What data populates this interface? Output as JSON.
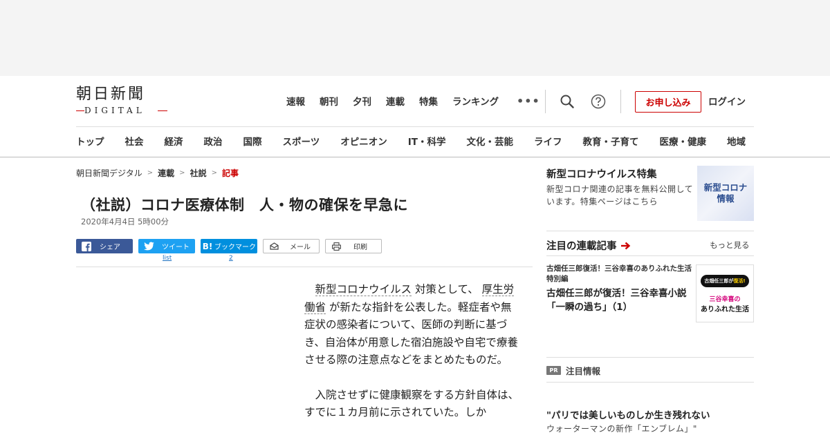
{
  "logo": {
    "main": "朝日新聞",
    "sub": "DIGITAL"
  },
  "topnav": [
    "速報",
    "朝刊",
    "夕刊",
    "連載",
    "特集",
    "ランキング"
  ],
  "topnav_more": "•••",
  "subscribe_label": "お申し込み",
  "login_label": "ログイン",
  "catnav": [
    "トップ",
    "社会",
    "経済",
    "政治",
    "国際",
    "スポーツ",
    "オピニオン",
    "IT・科学",
    "文化・芸能",
    "ライフ",
    "教育・子育て",
    "医療・健康",
    "地域"
  ],
  "breadcrumb": {
    "home": "朝日新聞デジタル",
    "section": "連載",
    "subsection": "社説",
    "current": "記事"
  },
  "article": {
    "title": "（社説）コロナ医療体制　人・物の確保を早急に",
    "date": "2020年4月4日 5時00分",
    "para1_link1": "新型コロナウイルス",
    "para1_text1": " 対策として、 ",
    "para1_link2": "厚生労働省",
    "para1_text2": " が新たな指針を公表した。軽症者や無症状の感染者について、医師の判断に基づき、自治体が用意した宿泊施設や自宅で療養させる際の注意点などをまとめたものだ。",
    "para2": "入院させずに健康観察をする方針自体は、すでに１カ月前に示されていた。しか"
  },
  "share": {
    "facebook": "シェア",
    "twitter": "ツイート",
    "twitter_count": "list",
    "hatena": "ブックマーク",
    "hatena_count": "2",
    "mail": "メール",
    "print": "印刷"
  },
  "sidebar": {
    "corona": {
      "title": "新型コロナウイルス特集",
      "desc": "新型コロナ関連の記事を無料公開しています。特集ページはこちら",
      "thumb_line1": "新型コロナ",
      "thumb_line2": "情報"
    },
    "rensai": {
      "title": "注目の連載記事",
      "more": "もっと見る",
      "kicker": "古畑任三郎復活！三谷幸喜のありふれた生活特別編",
      "headline": "古畑任三郎が復活！三谷幸喜小説「一瞬の過ち」（1）",
      "thumb_tag": "古畑任三郎が",
      "thumb_tag_em": "復活!",
      "thumb_line1": "三谷幸喜の",
      "thumb_line2": "ありふれた生活"
    },
    "pr": {
      "badge": "PR",
      "label": "注目情報"
    },
    "promo": {
      "headline": "\"パリでは美しいものしか生き残れない",
      "sub": "ウォーターマンの新作「エンブレム」\""
    }
  },
  "colors": {
    "accent": "#cc0000",
    "facebook": "#3b5998",
    "twitter": "#1da1f2",
    "hatena": "#008fde"
  }
}
